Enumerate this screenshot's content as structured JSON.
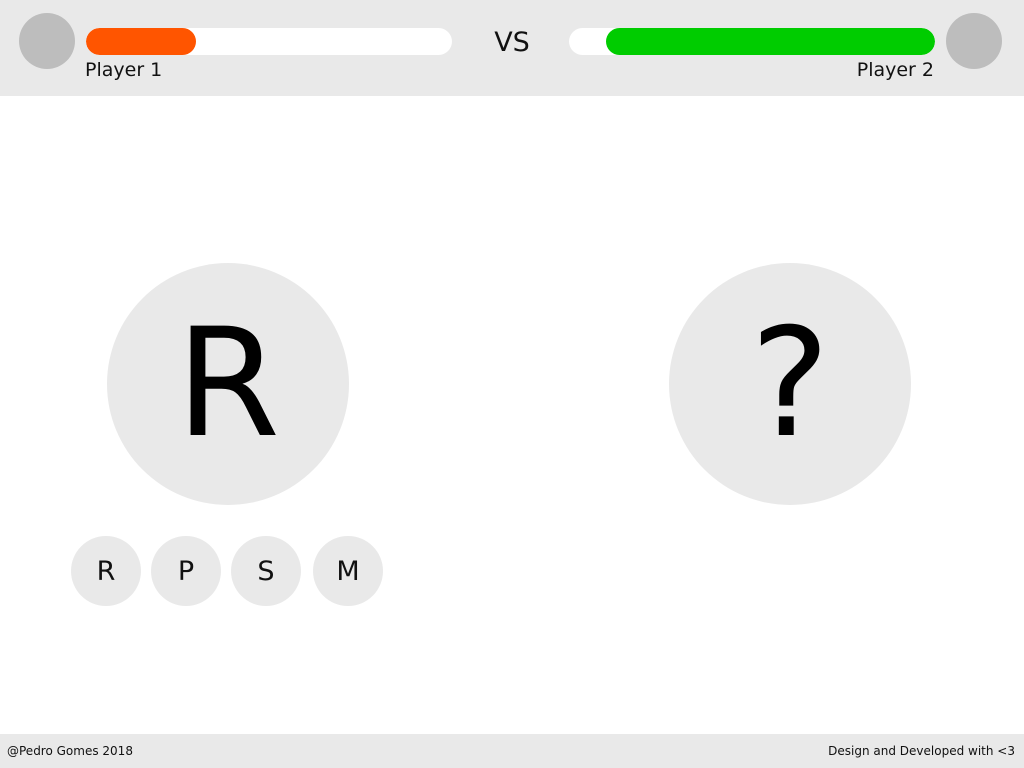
{
  "colors": {
    "player1_bar": "#ff5500",
    "player2_bar": "#00cc00",
    "panel_bg": "#e9e9e9",
    "avatar": "#bdbdbd"
  },
  "header": {
    "vs_label": "VS",
    "player1": {
      "name": "Player 1",
      "health_fraction": 0.3,
      "avatar_icon": "player-avatar-icon"
    },
    "player2": {
      "name": "Player 2",
      "health_fraction": 0.9,
      "avatar_icon": "player-avatar-icon"
    }
  },
  "arena": {
    "player1_choice": "R",
    "player2_choice": "?"
  },
  "moves": [
    {
      "label": "R"
    },
    {
      "label": "P"
    },
    {
      "label": "S"
    },
    {
      "label": "M"
    }
  ],
  "footer": {
    "left": "@Pedro Gomes 2018",
    "right": "Design and Developed with <3"
  }
}
